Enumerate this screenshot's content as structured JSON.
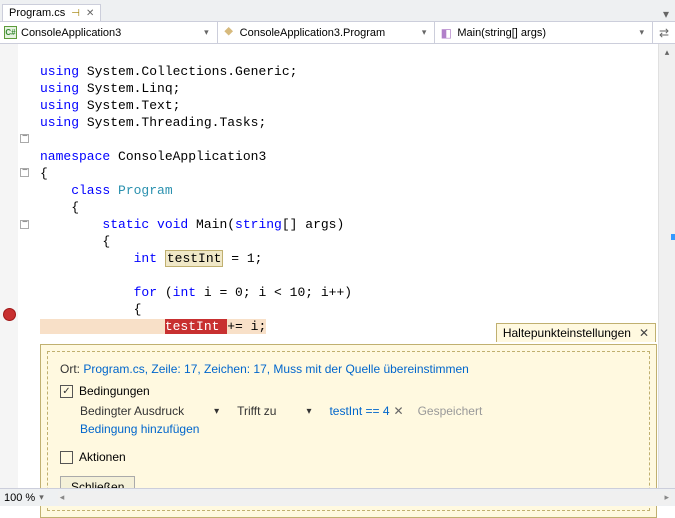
{
  "tab": {
    "name": "Program.cs"
  },
  "nav": {
    "project": "ConsoleApplication3",
    "class": "ConsoleApplication3.Program",
    "method": "Main(string[] args)"
  },
  "code": {
    "l1a": "using",
    "l1b": " System.Collections.Generic;",
    "l2a": "using",
    "l2b": " System.Linq;",
    "l3a": "using",
    "l3b": " System.Text;",
    "l4a": "using",
    "l4b": " System.Threading.Tasks;",
    "l6a": "namespace",
    "l6b": " ConsoleApplication3",
    "l7": "{",
    "l8a": "    class",
    "l8b": " Program",
    "l9": "    {",
    "l10a": "        static",
    "l10b": " void",
    "l10c": " Main(",
    "l10d": "string",
    "l10e": "[] args)",
    "l11": "        {",
    "l12a": "            int",
    "l12b": " ",
    "l12c": "testInt",
    "l12d": " = 1;",
    "l14a": "            for",
    "l14b": " (",
    "l14c": "int",
    "l14d": " i = 0; i < 10; i++)",
    "l15": "            {",
    "l16pad": "                ",
    "l16a": "testInt ",
    "l16b": "+= i;"
  },
  "panel": {
    "title": "Haltepunkteinstellungen",
    "loc_label": "Ort: ",
    "loc_link": "Program.cs, Zeile: 17, Zeichen: 17, Muss mit der Quelle übereinstimmen",
    "conditions_label": "Bedingungen",
    "cond_type": "Bedingter Ausdruck",
    "cond_hit": "Trifft zu",
    "cond_expr": "testInt == 4",
    "saved": "Gespeichert",
    "add_condition": "Bedingung hinzufügen",
    "actions_label": "Aktionen",
    "close_btn": "Schließen"
  },
  "status": {
    "zoom": "100 %"
  }
}
